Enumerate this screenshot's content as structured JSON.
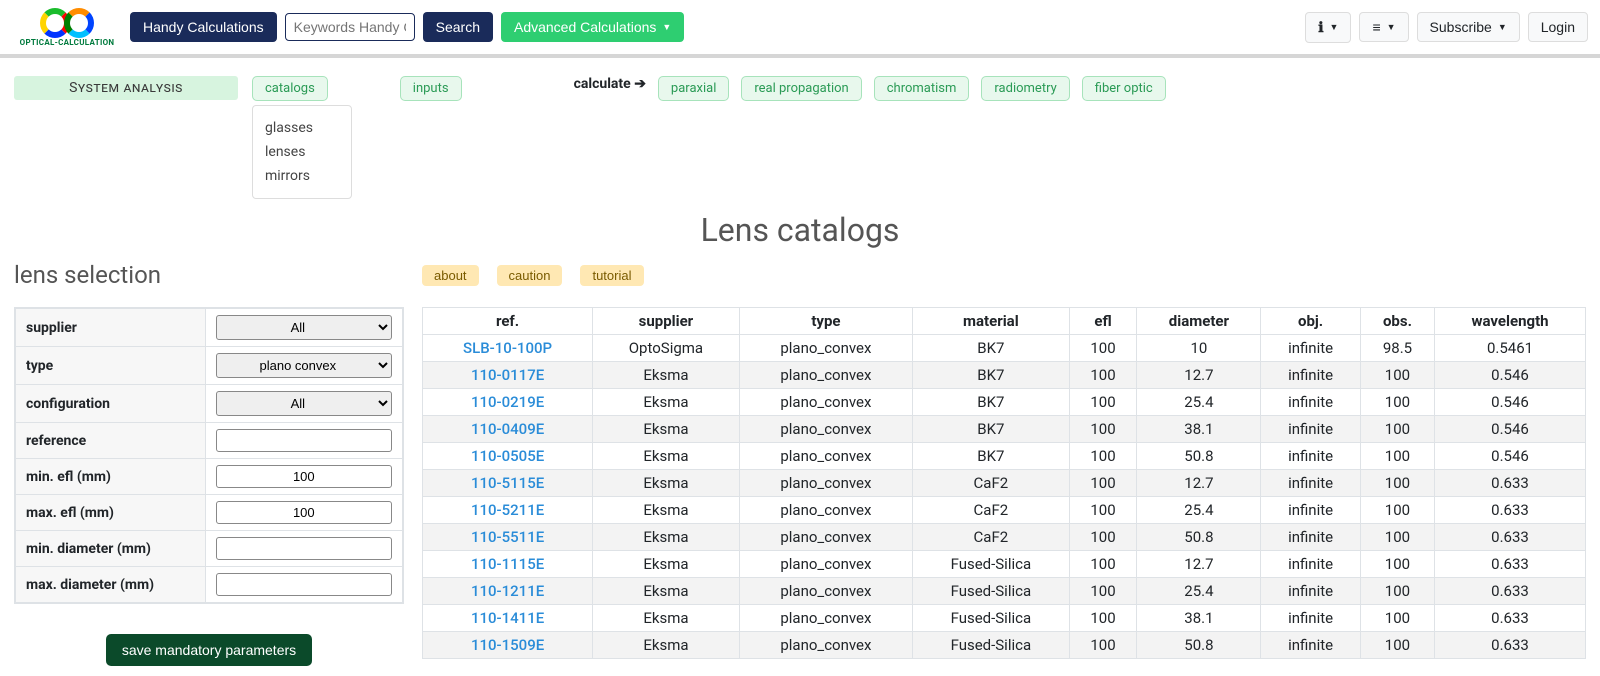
{
  "nav": {
    "handy": "Handy Calculations",
    "search_placeholder": "Keywords Handy Calc...",
    "search_btn": "Search",
    "advanced": "Advanced Calculations",
    "subscribe": "Subscribe",
    "login": "Login"
  },
  "subnav": {
    "system_analysis": "System analysis",
    "catalogs": "catalogs",
    "inputs": "inputs",
    "calculate": "calculate",
    "paraxial": "paraxial",
    "real_propagation": "real propagation",
    "chromatism": "chromatism",
    "radiometry": "radiometry",
    "fiber_optic": "fiber optic",
    "dropdown": {
      "glasses": "glasses",
      "lenses": "lenses",
      "mirrors": "mirrors"
    }
  },
  "page_title": "Lens catalogs",
  "lens_selection_title": "lens selection",
  "help": {
    "about": "about",
    "caution": "caution",
    "tutorial": "tutorial"
  },
  "filters": {
    "labels": {
      "supplier": "supplier",
      "type": "type",
      "configuration": "configuration",
      "reference": "reference",
      "min_efl": "min. efl (mm)",
      "max_efl": "max. efl (mm)",
      "min_diameter": "min. diameter (mm)",
      "max_diameter": "max. diameter (mm)"
    },
    "values": {
      "supplier": "All",
      "type": "plano convex",
      "configuration": "All",
      "reference": "",
      "min_efl": "100",
      "max_efl": "100",
      "min_diameter": "",
      "max_diameter": ""
    },
    "save_btn": "save mandatory parameters"
  },
  "table": {
    "headers": {
      "ref": "ref.",
      "supplier": "supplier",
      "type": "type",
      "material": "material",
      "efl": "efl",
      "diameter": "diameter",
      "obj": "obj.",
      "obs": "obs.",
      "wavelength": "wavelength"
    },
    "rows": [
      {
        "ref": "SLB-10-100P",
        "supplier": "OptoSigma",
        "type": "plano_convex",
        "material": "BK7",
        "efl": "100",
        "diameter": "10",
        "obj": "infinite",
        "obs": "98.5",
        "wavelength": "0.5461"
      },
      {
        "ref": "110-0117E",
        "supplier": "Eksma",
        "type": "plano_convex",
        "material": "BK7",
        "efl": "100",
        "diameter": "12.7",
        "obj": "infinite",
        "obs": "100",
        "wavelength": "0.546"
      },
      {
        "ref": "110-0219E",
        "supplier": "Eksma",
        "type": "plano_convex",
        "material": "BK7",
        "efl": "100",
        "diameter": "25.4",
        "obj": "infinite",
        "obs": "100",
        "wavelength": "0.546"
      },
      {
        "ref": "110-0409E",
        "supplier": "Eksma",
        "type": "plano_convex",
        "material": "BK7",
        "efl": "100",
        "diameter": "38.1",
        "obj": "infinite",
        "obs": "100",
        "wavelength": "0.546"
      },
      {
        "ref": "110-0505E",
        "supplier": "Eksma",
        "type": "plano_convex",
        "material": "BK7",
        "efl": "100",
        "diameter": "50.8",
        "obj": "infinite",
        "obs": "100",
        "wavelength": "0.546"
      },
      {
        "ref": "110-5115E",
        "supplier": "Eksma",
        "type": "plano_convex",
        "material": "CaF2",
        "efl": "100",
        "diameter": "12.7",
        "obj": "infinite",
        "obs": "100",
        "wavelength": "0.633"
      },
      {
        "ref": "110-5211E",
        "supplier": "Eksma",
        "type": "plano_convex",
        "material": "CaF2",
        "efl": "100",
        "diameter": "25.4",
        "obj": "infinite",
        "obs": "100",
        "wavelength": "0.633"
      },
      {
        "ref": "110-5511E",
        "supplier": "Eksma",
        "type": "plano_convex",
        "material": "CaF2",
        "efl": "100",
        "diameter": "50.8",
        "obj": "infinite",
        "obs": "100",
        "wavelength": "0.633"
      },
      {
        "ref": "110-1115E",
        "supplier": "Eksma",
        "type": "plano_convex",
        "material": "Fused-Silica",
        "efl": "100",
        "diameter": "12.7",
        "obj": "infinite",
        "obs": "100",
        "wavelength": "0.633"
      },
      {
        "ref": "110-1211E",
        "supplier": "Eksma",
        "type": "plano_convex",
        "material": "Fused-Silica",
        "efl": "100",
        "diameter": "25.4",
        "obj": "infinite",
        "obs": "100",
        "wavelength": "0.633"
      },
      {
        "ref": "110-1411E",
        "supplier": "Eksma",
        "type": "plano_convex",
        "material": "Fused-Silica",
        "efl": "100",
        "diameter": "38.1",
        "obj": "infinite",
        "obs": "100",
        "wavelength": "0.633"
      },
      {
        "ref": "110-1509E",
        "supplier": "Eksma",
        "type": "plano_convex",
        "material": "Fused-Silica",
        "efl": "100",
        "diameter": "50.8",
        "obj": "infinite",
        "obs": "100",
        "wavelength": "0.633"
      }
    ]
  }
}
